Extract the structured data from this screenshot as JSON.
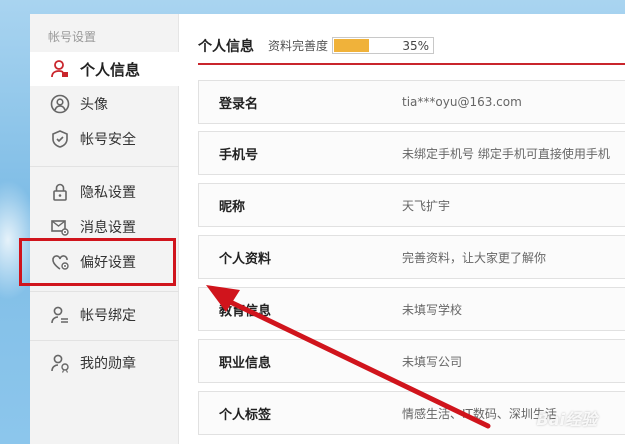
{
  "sidebar": {
    "section_title": "帐号设置",
    "items": [
      {
        "label": "个人信息",
        "icon": "user-icon"
      },
      {
        "label": "头像",
        "icon": "avatar-icon"
      },
      {
        "label": "帐号安全",
        "icon": "shield-icon"
      },
      {
        "label": "隐私设置",
        "icon": "lock-icon"
      },
      {
        "label": "消息设置",
        "icon": "mail-gear-icon"
      },
      {
        "label": "偏好设置",
        "icon": "heart-gear-icon"
      },
      {
        "label": "帐号绑定",
        "icon": "user-link-icon"
      },
      {
        "label": "我的勋章",
        "icon": "medal-user-icon"
      }
    ]
  },
  "header": {
    "title": "个人信息",
    "completion_label": "资料完善度",
    "completion_percent_text": "35%",
    "completion_fraction": 0.35
  },
  "rows": [
    {
      "label": "登录名",
      "value": "tia***oyu@163.com"
    },
    {
      "label": "手机号",
      "value": "未绑定手机号 绑定手机可直接使用手机"
    },
    {
      "label": "昵称",
      "value": "天飞扩宇"
    },
    {
      "label": "个人资料",
      "value": "完善资料，让大家更了解你"
    },
    {
      "label": "教育信息",
      "value": "未填写学校"
    },
    {
      "label": "职业信息",
      "value": "未填写公司"
    },
    {
      "label": "个人标签",
      "value": "情感生活、IT数码、深圳生活"
    }
  ],
  "colors": {
    "accent_red": "#c9252c",
    "annotation_red": "#d0141c",
    "progress_fill": "#f0b23a"
  },
  "watermark": "Bai经验"
}
